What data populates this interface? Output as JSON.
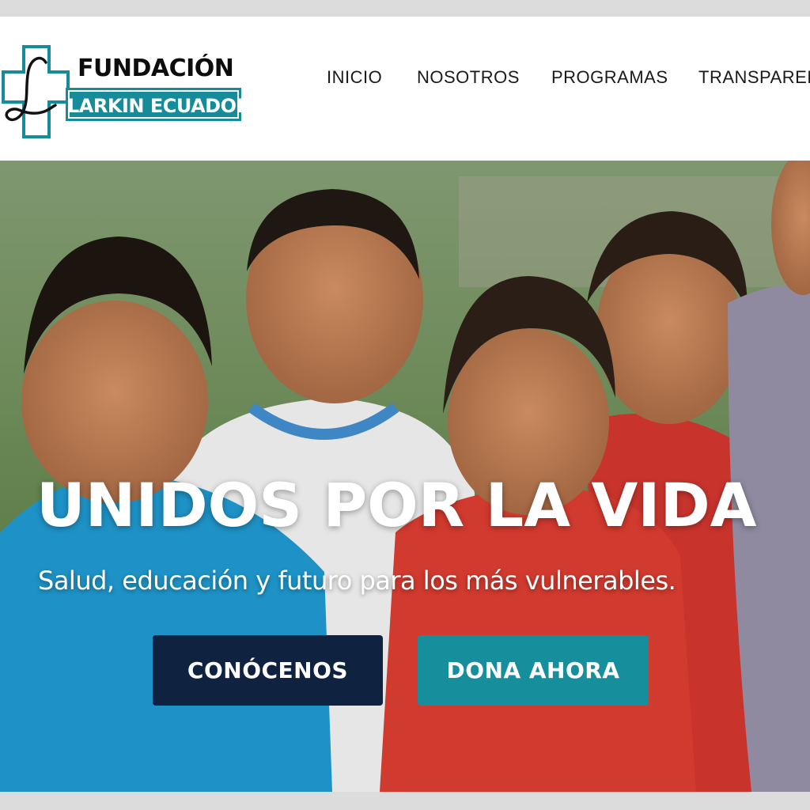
{
  "brand": {
    "line1": "FUNDACIÓN",
    "line2": "LARKIN ECUADOR",
    "monogram": "L",
    "accent_color": "#168c9a"
  },
  "nav": {
    "items": [
      {
        "label": "INICIO"
      },
      {
        "label": "NOSOTROS"
      },
      {
        "label": "PROGRAMAS"
      },
      {
        "label": "TRANSPAREN"
      }
    ]
  },
  "hero": {
    "title": "UNIDOS POR LA VIDA",
    "subtitle": "Salud, educación y futuro para los más vulnerables.",
    "primary_button": "CONÓCENOS",
    "donate_button": "DONA AHORA",
    "primary_color": "#0f2240",
    "donate_color": "#168e9c"
  }
}
